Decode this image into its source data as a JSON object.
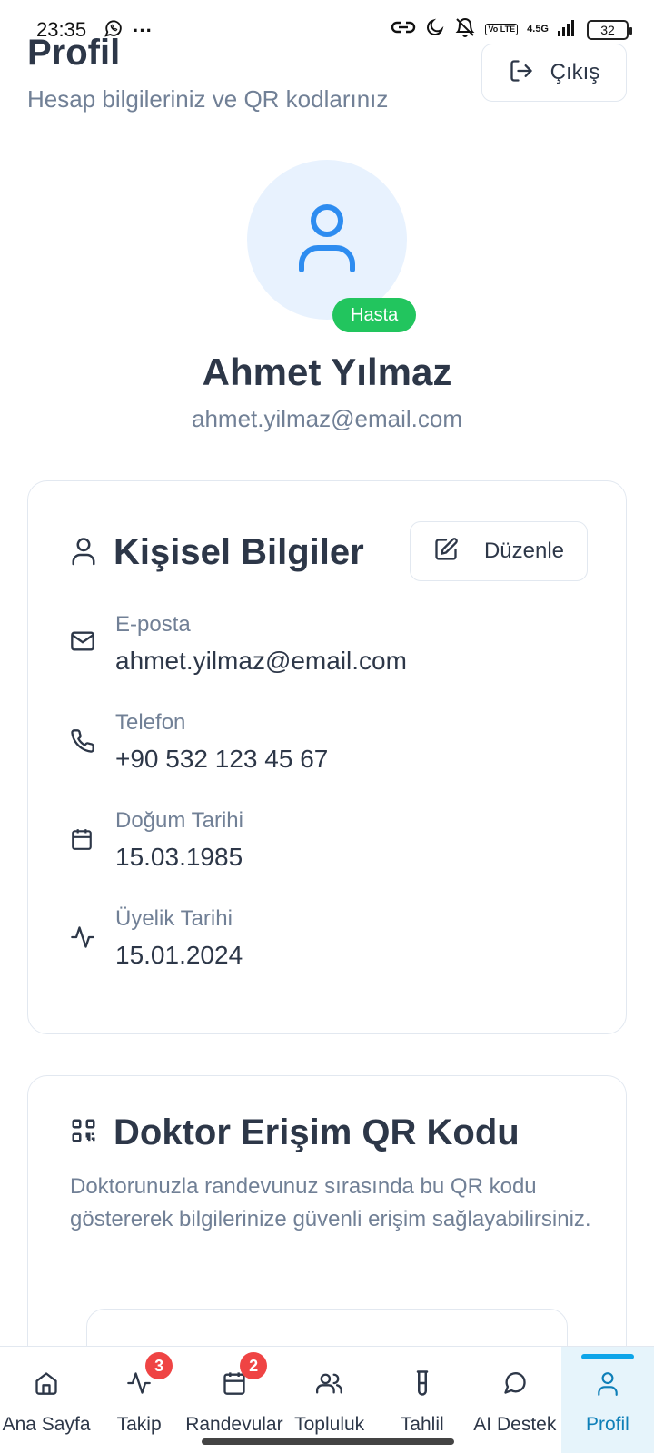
{
  "status_bar": {
    "time": "23:35",
    "ellipsis": "···",
    "network": "4.5G",
    "volte": "Vo LTE",
    "battery": "32"
  },
  "header": {
    "title": "Profil",
    "subtitle": "Hesap bilgileriniz ve QR kodlarınız",
    "logout_label": "Çıkış"
  },
  "profile": {
    "role_badge": "Hasta",
    "name": "Ahmet Yılmaz",
    "email": "ahmet.yilmaz@email.com"
  },
  "personal_info": {
    "title": "Kişisel Bilgiler",
    "edit_label": "Düzenle",
    "fields": [
      {
        "label": "E-posta",
        "value": "ahmet.yilmaz@email.com",
        "icon": "mail-icon"
      },
      {
        "label": "Telefon",
        "value": "+90 532 123 45 67",
        "icon": "phone-icon"
      },
      {
        "label": "Doğum Tarihi",
        "value": "15.03.1985",
        "icon": "calendar-icon"
      },
      {
        "label": "Üyelik Tarihi",
        "value": "15.01.2024",
        "icon": "activity-icon"
      }
    ]
  },
  "qr_section": {
    "title": "Doktor Erişim QR Kodu",
    "description": "Doktorunuzla randevunuz sırasında bu QR kodu göstererek bilgilerinize güvenli erişim sağlayabilirsiniz."
  },
  "bottom_nav": {
    "items": [
      {
        "label": "Ana Sayfa",
        "icon": "home-icon"
      },
      {
        "label": "Takip",
        "icon": "activity-icon",
        "badge": "3"
      },
      {
        "label": "Randevular",
        "icon": "calendar-icon",
        "badge": "2"
      },
      {
        "label": "Topluluk",
        "icon": "users-icon"
      },
      {
        "label": "Tahlil",
        "icon": "test-tube-icon"
      },
      {
        "label": "AI Destek",
        "icon": "chat-icon"
      },
      {
        "label": "Profil",
        "icon": "user-icon",
        "active": true
      }
    ]
  },
  "colors": {
    "accent": "#0ea5e9",
    "role_badge": "#22c55e",
    "notification_badge": "#ef4444",
    "avatar_bg": "#e8f2fe"
  }
}
